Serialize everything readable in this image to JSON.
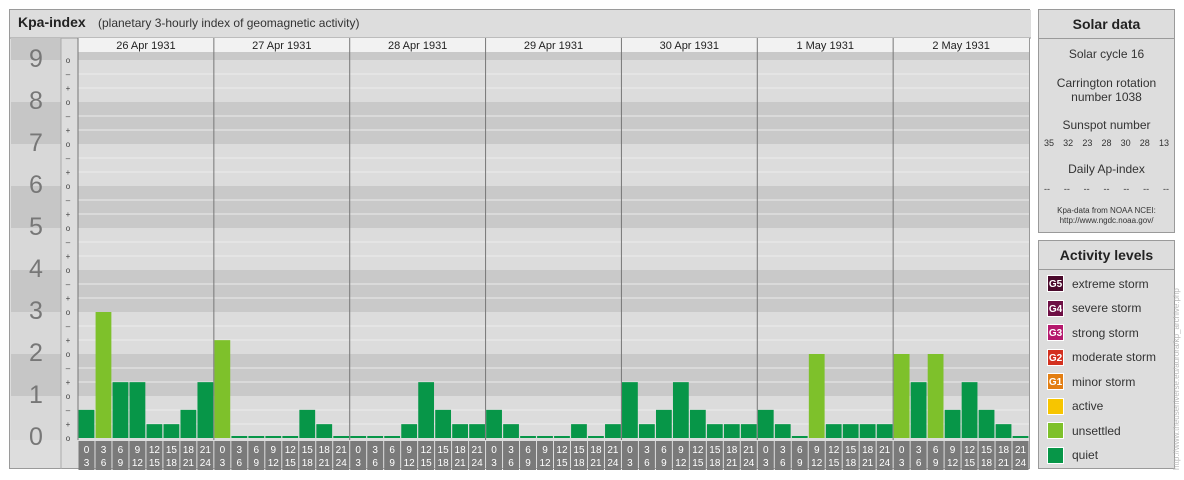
{
  "header": {
    "title": "Kpa-index",
    "subtitle": "(planetary 3-hourly index of geomagnetic activity)"
  },
  "chart_data": {
    "type": "bar",
    "title": "Kpa-index",
    "subtitle": "(planetary 3-hourly index of geomagnetic activity)",
    "ylim": [
      0,
      9
    ],
    "y_ticks": [
      "0",
      "1",
      "2",
      "3",
      "4",
      "5",
      "6",
      "7",
      "8",
      "9"
    ],
    "y_minor_ticks": [
      "o",
      "+",
      "–"
    ],
    "days": [
      "26 Apr 1931",
      "27 Apr 1931",
      "28 Apr 1931",
      "29 Apr 1931",
      "30 Apr 1931",
      "1 May 1931",
      "2 May 1931"
    ],
    "interval_top": [
      "0",
      "3",
      "6",
      "9",
      "12",
      "15",
      "18",
      "21"
    ],
    "interval_bottom": [
      "3",
      "6",
      "9",
      "12",
      "15",
      "18",
      "21",
      "24"
    ],
    "values": [
      [
        0.67,
        3.0,
        1.33,
        1.33,
        0.33,
        0.33,
        0.67,
        1.33
      ],
      [
        2.33,
        0,
        0,
        0,
        0,
        0.67,
        0.33,
        0
      ],
      [
        0,
        0,
        0,
        0.33,
        1.33,
        0.67,
        0.33,
        0.33
      ],
      [
        0.67,
        0.33,
        0,
        0,
        0,
        0.33,
        0,
        0.33
      ],
      [
        1.33,
        0.33,
        0.67,
        1.33,
        0.67,
        0.33,
        0.33,
        0.33
      ],
      [
        0.67,
        0.33,
        0,
        2.0,
        0.33,
        0.33,
        0.33,
        0.33
      ],
      [
        2.0,
        1.33,
        2.0,
        0.67,
        1.33,
        0.67,
        0.33,
        0
      ]
    ],
    "colors": {
      "quiet": "#079648",
      "unsettled": "#7ec12b"
    },
    "grid": true
  },
  "solar": {
    "title": "Solar data",
    "cycle": "Solar cycle 16",
    "carrington_1": "Carrington rotation",
    "carrington_2": "number 1038",
    "sunspot_label": "Sunspot number",
    "sunspots": [
      "35",
      "32",
      "23",
      "28",
      "30",
      "28",
      "13"
    ],
    "ap_label": "Daily Ap-index",
    "ap_values": [
      "--",
      "--",
      "--",
      "--",
      "--",
      "--",
      "--"
    ],
    "credit_1": "Kpa-data from NOAA NCEI:",
    "credit_2": "http://www.ngdc.noaa.gov/"
  },
  "activity": {
    "title": "Activity levels",
    "levels": [
      {
        "code": "G5",
        "label": "extreme storm",
        "color": "#4a0a2c"
      },
      {
        "code": "G4",
        "label": "severe storm",
        "color": "#6e0f45"
      },
      {
        "code": "G3",
        "label": "strong storm",
        "color": "#b5186d"
      },
      {
        "code": "G2",
        "label": "moderate storm",
        "color": "#d3301f"
      },
      {
        "code": "G1",
        "label": "minor storm",
        "color": "#e37e12"
      },
      {
        "code": "",
        "label": "active",
        "color": "#f7c500"
      },
      {
        "code": "",
        "label": "unsettled",
        "color": "#7ec12b"
      },
      {
        "code": "",
        "label": "quiet",
        "color": "#079648"
      }
    ]
  },
  "vertical_credit": "http://www.theuseniverse.eu/aurora/kp_archive.php"
}
